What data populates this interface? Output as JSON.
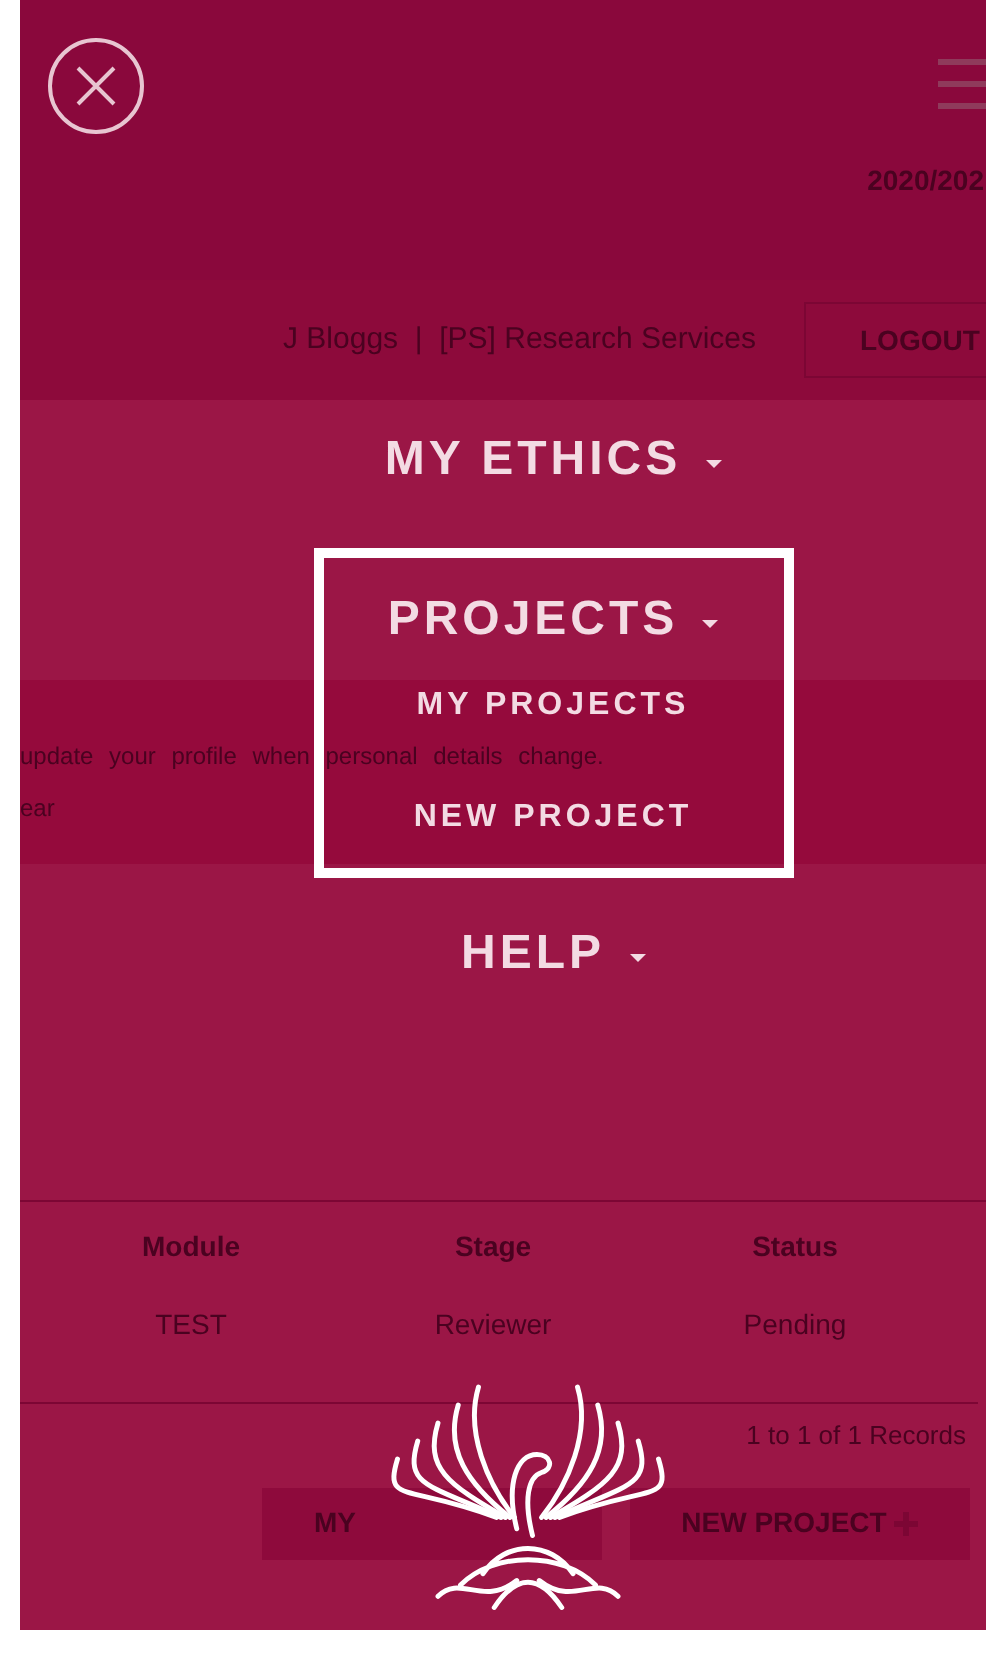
{
  "page": {
    "academic_year": "2020/202",
    "user": "J Bloggs  |  [PS] Research Services",
    "logout": "LOGOUT",
    "notice": [
      "update your profile when personal details change.",
      "ear"
    ],
    "table": {
      "columns": [
        "Module",
        "Stage",
        "Status"
      ],
      "rows": [
        [
          "TEST",
          "Reviewer",
          "Pending"
        ]
      ]
    },
    "records": "1 to 1 of 1 Records",
    "buttons": [
      {
        "label": "MY",
        "kind": "plain"
      },
      {
        "label": "NEW PROJECT",
        "kind": "add"
      }
    ]
  },
  "menu": [
    {
      "label": "MY ETHICS",
      "selected": false
    },
    {
      "label": "PROJECTS",
      "selected": true,
      "children": [
        "MY PROJECTS",
        "NEW PROJECT"
      ]
    },
    {
      "label": "HELP",
      "selected": false
    }
  ]
}
